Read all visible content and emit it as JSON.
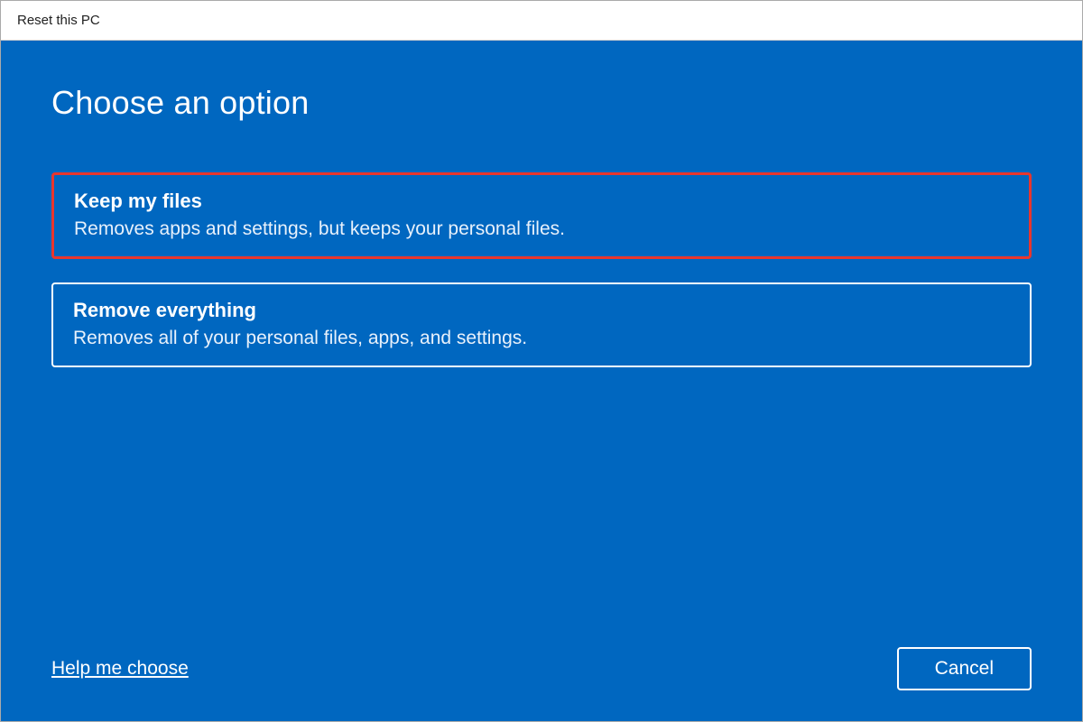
{
  "window": {
    "title": "Reset this PC"
  },
  "main": {
    "heading": "Choose an option",
    "options": [
      {
        "title": "Keep my files",
        "description": "Removes apps and settings, but keeps your personal files.",
        "highlighted": true
      },
      {
        "title": "Remove everything",
        "description": "Removes all of your personal files, apps, and settings.",
        "highlighted": false
      }
    ]
  },
  "footer": {
    "help_link": "Help me choose",
    "cancel_label": "Cancel"
  },
  "colors": {
    "accent": "#0067c0",
    "highlight_border": "#e8362d"
  }
}
